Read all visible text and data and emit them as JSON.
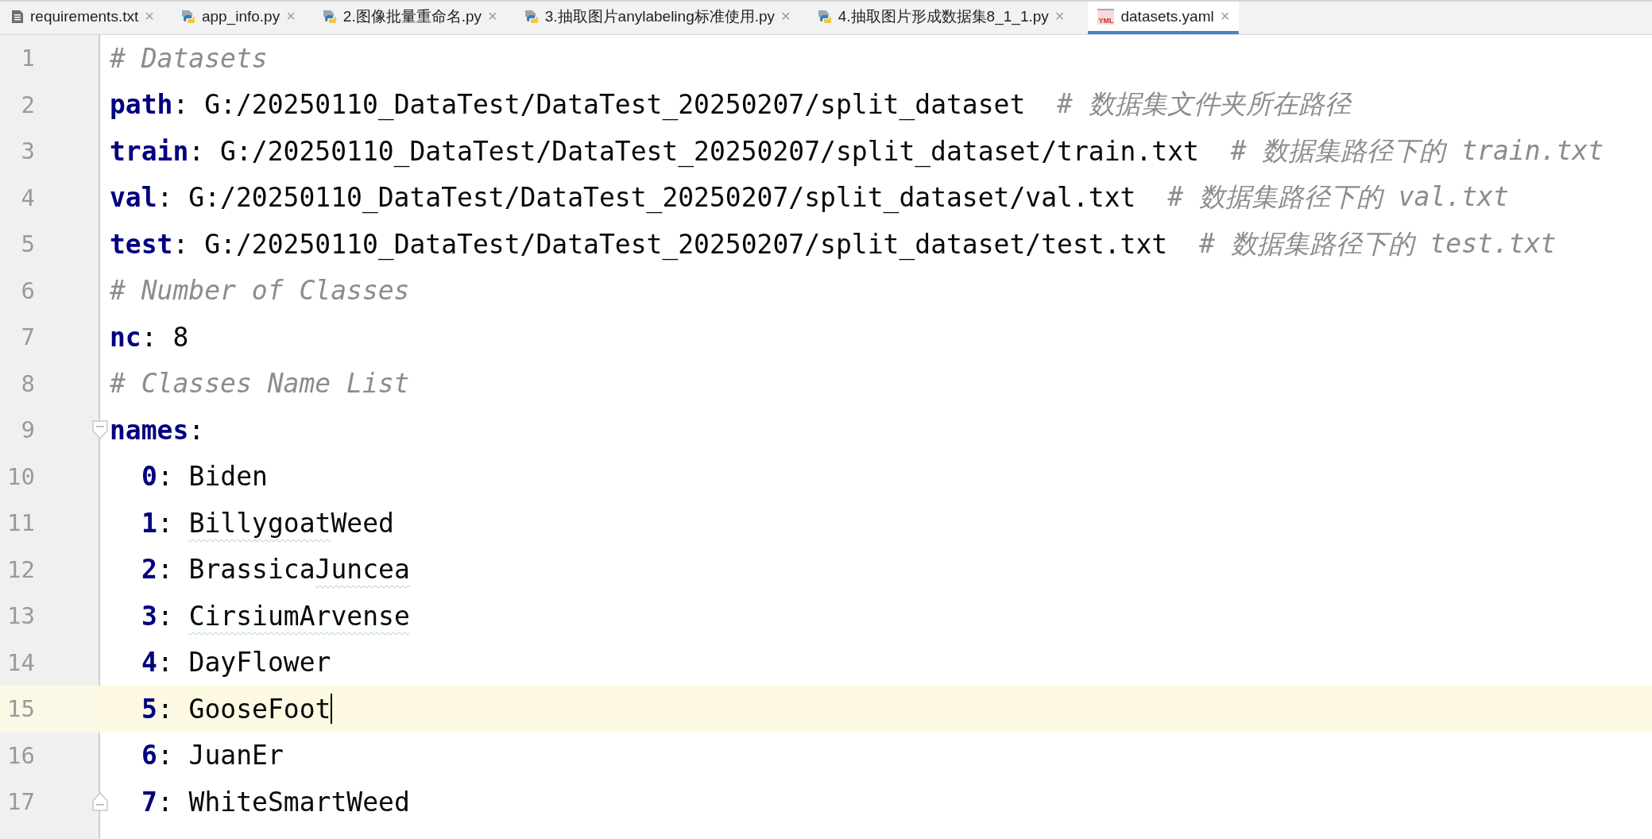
{
  "tabs": [
    {
      "label": "requirements.txt",
      "kind": "text",
      "close": "×",
      "selected": false
    },
    {
      "label": "app_info.py",
      "kind": "python",
      "close": "×",
      "selected": false
    },
    {
      "label": "2.图像批量重命名.py",
      "kind": "python",
      "close": "×",
      "selected": false
    },
    {
      "label": "3.抽取图片anylabeling标准使用.py",
      "kind": "python",
      "close": "×",
      "selected": false
    },
    {
      "label": "4.抽取图片形成数据集8_1_1.py",
      "kind": "python",
      "close": "×",
      "selected": false
    },
    {
      "label": "datasets.yaml",
      "kind": "yaml",
      "icon_text": "YML",
      "close": "×",
      "selected": true
    }
  ],
  "editor": {
    "lines": [
      {
        "number": "1",
        "current": false,
        "caret": false,
        "parts": [
          {
            "kind": "comment",
            "text": "# Datasets"
          }
        ]
      },
      {
        "number": "2",
        "current": false,
        "caret": false,
        "parts": [
          {
            "kind": "key",
            "text": "path"
          },
          {
            "kind": "plain",
            "text": ": G:/20250110_DataTest/DataTest_20250207/split_dataset  "
          },
          {
            "kind": "comment",
            "text": "# 数据集文件夹所在路径"
          }
        ]
      },
      {
        "number": "3",
        "current": false,
        "caret": false,
        "parts": [
          {
            "kind": "key",
            "text": "train"
          },
          {
            "kind": "plain",
            "text": ": G:/20250110_DataTest/DataTest_20250207/split_dataset/train.txt  "
          },
          {
            "kind": "comment",
            "text": "# 数据集路径下的 train.txt"
          }
        ]
      },
      {
        "number": "4",
        "current": false,
        "caret": false,
        "parts": [
          {
            "kind": "key",
            "text": "val"
          },
          {
            "kind": "plain",
            "text": ": G:/20250110_DataTest/DataTest_20250207/split_dataset/val.txt  "
          },
          {
            "kind": "comment",
            "text": "# 数据集路径下的 val.txt"
          }
        ]
      },
      {
        "number": "5",
        "current": false,
        "caret": false,
        "parts": [
          {
            "kind": "key",
            "text": "test"
          },
          {
            "kind": "plain",
            "text": ": G:/20250110_DataTest/DataTest_20250207/split_dataset/test.txt  "
          },
          {
            "kind": "comment",
            "text": "# 数据集路径下的 test.txt"
          }
        ]
      },
      {
        "number": "6",
        "current": false,
        "caret": false,
        "parts": [
          {
            "kind": "comment",
            "text": "# Number of Classes"
          }
        ]
      },
      {
        "number": "7",
        "current": false,
        "caret": false,
        "parts": [
          {
            "kind": "key",
            "text": "nc"
          },
          {
            "kind": "plain",
            "text": ": 8"
          }
        ]
      },
      {
        "number": "8",
        "current": false,
        "caret": false,
        "parts": [
          {
            "kind": "comment",
            "text": "# Classes Name List"
          }
        ]
      },
      {
        "number": "9",
        "current": false,
        "caret": false,
        "expanded": true,
        "parts": [
          {
            "kind": "key",
            "text": "names"
          },
          {
            "kind": "plain",
            "text": ":"
          }
        ],
        "children": [
          {
            "number": "10",
            "current": false,
            "caret": false,
            "parts": [
              {
                "kind": "key",
                "text": "0"
              },
              {
                "kind": "plain",
                "text": ": Biden"
              }
            ]
          },
          {
            "number": "11",
            "current": false,
            "caret": false,
            "parts": [
              {
                "kind": "key",
                "text": "1"
              },
              {
                "kind": "plain",
                "text": ": "
              },
              {
                "kind": "typo",
                "text": "Billygoat"
              },
              {
                "kind": "plain",
                "text": "Weed"
              }
            ]
          },
          {
            "number": "12",
            "current": false,
            "caret": false,
            "parts": [
              {
                "kind": "key",
                "text": "2"
              },
              {
                "kind": "plain",
                "text": ": Brassica"
              },
              {
                "kind": "typo",
                "text": "Juncea"
              }
            ]
          },
          {
            "number": "13",
            "current": false,
            "caret": false,
            "parts": [
              {
                "kind": "key",
                "text": "3"
              },
              {
                "kind": "plain",
                "text": ": "
              },
              {
                "kind": "typo",
                "text": "CirsiumArvense"
              }
            ]
          },
          {
            "number": "14",
            "current": false,
            "caret": false,
            "parts": [
              {
                "kind": "key",
                "text": "4"
              },
              {
                "kind": "plain",
                "text": ": DayFlower"
              }
            ]
          },
          {
            "number": "15",
            "current": true,
            "caret": true,
            "parts": [
              {
                "kind": "key",
                "text": "5"
              },
              {
                "kind": "plain",
                "text": ": GooseFoot"
              }
            ]
          },
          {
            "number": "16",
            "current": false,
            "caret": false,
            "parts": [
              {
                "kind": "key",
                "text": "6"
              },
              {
                "kind": "plain",
                "text": ": JuanEr"
              }
            ]
          },
          {
            "number": "17",
            "current": false,
            "caret": false,
            "parts": [
              {
                "kind": "key",
                "text": "7"
              },
              {
                "kind": "plain",
                "text": ": WhiteSmartWeed"
              }
            ]
          }
        ]
      }
    ]
  }
}
